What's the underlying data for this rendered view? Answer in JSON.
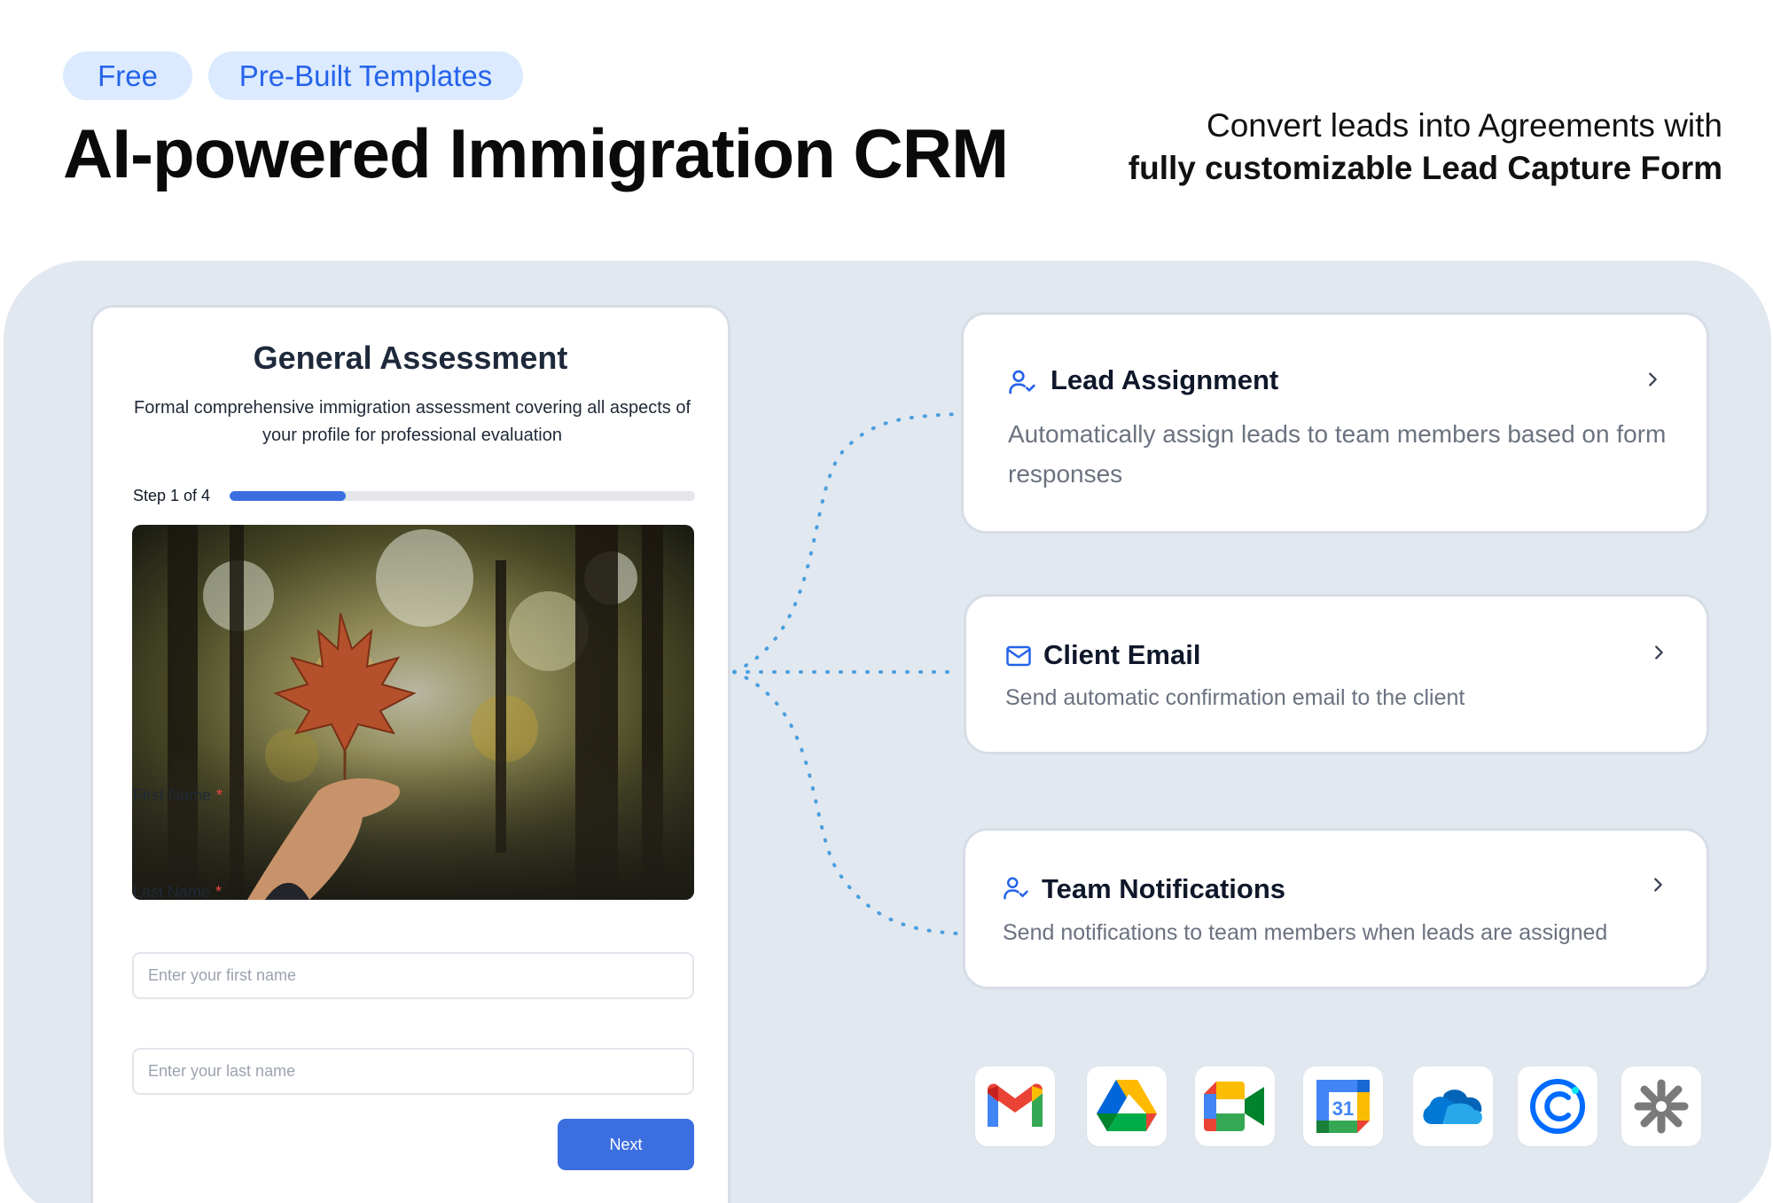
{
  "header": {
    "badges": [
      "Free",
      "Pre-Built Templates"
    ],
    "title": "AI-powered Immigration CRM",
    "tagline_line1": "Convert leads into Agreements with",
    "tagline_line2": "fully customizable Lead Capture Form"
  },
  "form": {
    "title": "General Assessment",
    "description": "Formal comprehensive immigration assessment covering all aspects of your profile for professional evaluation",
    "step_label": "Step 1 of 4",
    "progress": 0.25,
    "image_icon": "maple-leaf-in-hand-photo",
    "fields": [
      {
        "label": "First Name",
        "required_mark": "*",
        "placeholder": "Enter your first name",
        "value": ""
      },
      {
        "label": "Last Name",
        "required_mark": "*",
        "placeholder": "Enter your last name",
        "value": ""
      }
    ],
    "next_label": "Next"
  },
  "features": [
    {
      "icon": "user-check-icon",
      "title": "Lead Assignment",
      "description": "Automatically assign leads to team members based on form responses",
      "chevron": "chevron-right-icon"
    },
    {
      "icon": "mail-icon",
      "title": "Client Email",
      "description": "Send automatic confirmation email to the client",
      "chevron": "chevron-right-icon"
    },
    {
      "icon": "user-check-icon",
      "title": "Team Notifications",
      "description": "Send notifications to team members when leads are assigned",
      "chevron": "chevron-right-icon"
    }
  ],
  "integrations": [
    {
      "name": "gmail-icon"
    },
    {
      "name": "google-drive-icon"
    },
    {
      "name": "google-meet-icon"
    },
    {
      "name": "google-calendar-icon",
      "text": "31"
    },
    {
      "name": "onedrive-icon"
    },
    {
      "name": "calendly-icon"
    },
    {
      "name": "zapier-icon"
    }
  ],
  "colors": {
    "accent": "#3b6fe0",
    "badge_bg": "#dbeafe",
    "badge_text": "#2563eb",
    "panel_bg": "#e2e8f0",
    "connector": "#4a9fe0",
    "required": "#ef4444"
  }
}
